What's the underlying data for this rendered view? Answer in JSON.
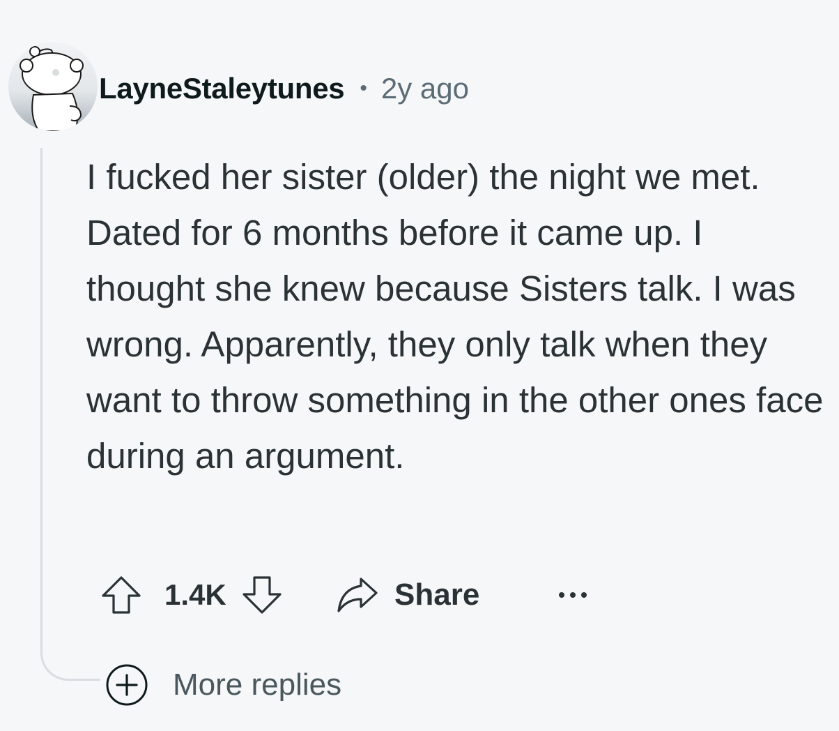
{
  "comment": {
    "author": "LayneStaleytunes",
    "separator": "•",
    "timestamp": "2y ago",
    "body": "I fucked her sister (older) the night we met. Dated for 6 months before it came up. I thought she knew because Sisters talk. I was wrong. Apparently, they only talk when they want to throw something in the other ones face during an argument.",
    "score": "1.4K",
    "share_label": "Share",
    "more_replies_label": "More replies"
  },
  "icons": {
    "avatar": "snoo-avatar-icon",
    "upvote": "arrow-up-icon",
    "downvote": "arrow-down-icon",
    "share": "share-arrow-icon",
    "overflow": "ellipsis-icon",
    "expand": "plus-circle-icon"
  },
  "colors": {
    "background": "#f6f7f9",
    "text": "#2a3236",
    "username": "#0f1a1c",
    "meta": "#5c6c74",
    "thread_line": "#d7dde0"
  }
}
